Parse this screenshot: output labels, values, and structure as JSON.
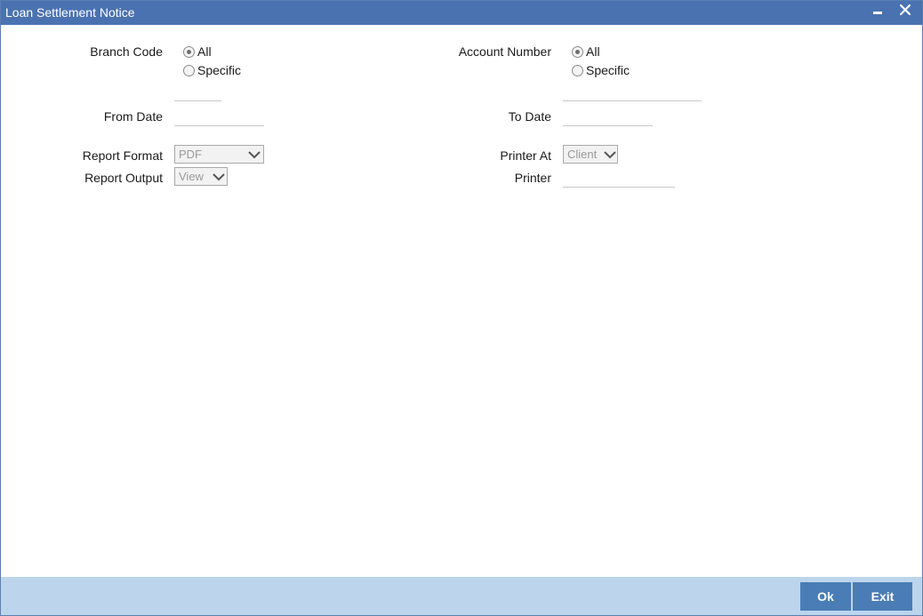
{
  "window": {
    "title": "Loan Settlement Notice",
    "minimize_icon": "minimize-icon",
    "close_icon": "close-icon"
  },
  "form": {
    "branch_code": {
      "label": "Branch Code",
      "options": [
        "All",
        "Specific"
      ],
      "selected": "All",
      "value": ""
    },
    "account_number": {
      "label": "Account Number",
      "options": [
        "All",
        "Specific"
      ],
      "selected": "All",
      "value": ""
    },
    "from_date": {
      "label": "From Date",
      "value": ""
    },
    "to_date": {
      "label": "To Date",
      "value": ""
    },
    "report_format": {
      "label": "Report Format",
      "value": "PDF"
    },
    "report_output": {
      "label": "Report Output",
      "value": "View"
    },
    "printer_at": {
      "label": "Printer At",
      "value": "Client"
    },
    "printer": {
      "label": "Printer",
      "value": ""
    }
  },
  "footer": {
    "ok_label": "Ok",
    "exit_label": "Exit"
  },
  "colors": {
    "titlebar": "#4a72b1",
    "footer": "#bcd5ec",
    "button": "#4a7db5"
  }
}
